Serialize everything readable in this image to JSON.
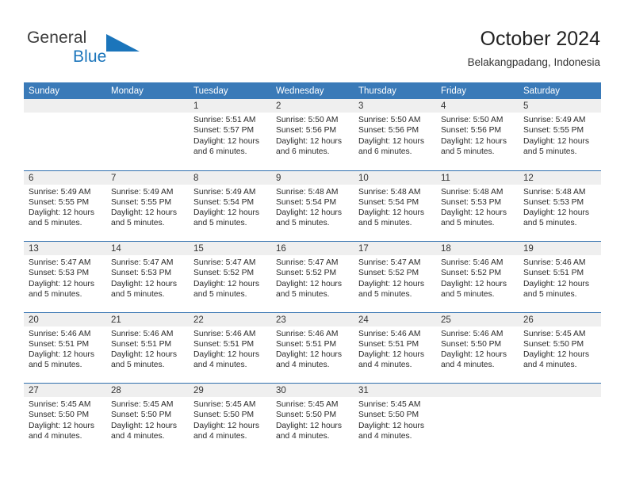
{
  "brand": {
    "name_part1": "General",
    "name_part2": "Blue",
    "triangle_icon": "triangle-icon",
    "accent_color": "#1b75bb"
  },
  "header": {
    "title": "October 2024",
    "location": "Belakangpadang, Indonesia"
  },
  "calendar": {
    "header_bg": "#3a7ab8",
    "daynum_bg": "#efefef",
    "row_line_color": "#2f6fae",
    "weekday_headers": [
      "Sunday",
      "Monday",
      "Tuesday",
      "Wednesday",
      "Thursday",
      "Friday",
      "Saturday"
    ],
    "weeks": [
      [
        {
          "day": "",
          "sunrise": "",
          "sunset": "",
          "daylight": ""
        },
        {
          "day": "",
          "sunrise": "",
          "sunset": "",
          "daylight": ""
        },
        {
          "day": "1",
          "sunrise": "Sunrise: 5:51 AM",
          "sunset": "Sunset: 5:57 PM",
          "daylight": "Daylight: 12 hours and 6 minutes."
        },
        {
          "day": "2",
          "sunrise": "Sunrise: 5:50 AM",
          "sunset": "Sunset: 5:56 PM",
          "daylight": "Daylight: 12 hours and 6 minutes."
        },
        {
          "day": "3",
          "sunrise": "Sunrise: 5:50 AM",
          "sunset": "Sunset: 5:56 PM",
          "daylight": "Daylight: 12 hours and 6 minutes."
        },
        {
          "day": "4",
          "sunrise": "Sunrise: 5:50 AM",
          "sunset": "Sunset: 5:56 PM",
          "daylight": "Daylight: 12 hours and 5 minutes."
        },
        {
          "day": "5",
          "sunrise": "Sunrise: 5:49 AM",
          "sunset": "Sunset: 5:55 PM",
          "daylight": "Daylight: 12 hours and 5 minutes."
        }
      ],
      [
        {
          "day": "6",
          "sunrise": "Sunrise: 5:49 AM",
          "sunset": "Sunset: 5:55 PM",
          "daylight": "Daylight: 12 hours and 5 minutes."
        },
        {
          "day": "7",
          "sunrise": "Sunrise: 5:49 AM",
          "sunset": "Sunset: 5:55 PM",
          "daylight": "Daylight: 12 hours and 5 minutes."
        },
        {
          "day": "8",
          "sunrise": "Sunrise: 5:49 AM",
          "sunset": "Sunset: 5:54 PM",
          "daylight": "Daylight: 12 hours and 5 minutes."
        },
        {
          "day": "9",
          "sunrise": "Sunrise: 5:48 AM",
          "sunset": "Sunset: 5:54 PM",
          "daylight": "Daylight: 12 hours and 5 minutes."
        },
        {
          "day": "10",
          "sunrise": "Sunrise: 5:48 AM",
          "sunset": "Sunset: 5:54 PM",
          "daylight": "Daylight: 12 hours and 5 minutes."
        },
        {
          "day": "11",
          "sunrise": "Sunrise: 5:48 AM",
          "sunset": "Sunset: 5:53 PM",
          "daylight": "Daylight: 12 hours and 5 minutes."
        },
        {
          "day": "12",
          "sunrise": "Sunrise: 5:48 AM",
          "sunset": "Sunset: 5:53 PM",
          "daylight": "Daylight: 12 hours and 5 minutes."
        }
      ],
      [
        {
          "day": "13",
          "sunrise": "Sunrise: 5:47 AM",
          "sunset": "Sunset: 5:53 PM",
          "daylight": "Daylight: 12 hours and 5 minutes."
        },
        {
          "day": "14",
          "sunrise": "Sunrise: 5:47 AM",
          "sunset": "Sunset: 5:53 PM",
          "daylight": "Daylight: 12 hours and 5 minutes."
        },
        {
          "day": "15",
          "sunrise": "Sunrise: 5:47 AM",
          "sunset": "Sunset: 5:52 PM",
          "daylight": "Daylight: 12 hours and 5 minutes."
        },
        {
          "day": "16",
          "sunrise": "Sunrise: 5:47 AM",
          "sunset": "Sunset: 5:52 PM",
          "daylight": "Daylight: 12 hours and 5 minutes."
        },
        {
          "day": "17",
          "sunrise": "Sunrise: 5:47 AM",
          "sunset": "Sunset: 5:52 PM",
          "daylight": "Daylight: 12 hours and 5 minutes."
        },
        {
          "day": "18",
          "sunrise": "Sunrise: 5:46 AM",
          "sunset": "Sunset: 5:52 PM",
          "daylight": "Daylight: 12 hours and 5 minutes."
        },
        {
          "day": "19",
          "sunrise": "Sunrise: 5:46 AM",
          "sunset": "Sunset: 5:51 PM",
          "daylight": "Daylight: 12 hours and 5 minutes."
        }
      ],
      [
        {
          "day": "20",
          "sunrise": "Sunrise: 5:46 AM",
          "sunset": "Sunset: 5:51 PM",
          "daylight": "Daylight: 12 hours and 5 minutes."
        },
        {
          "day": "21",
          "sunrise": "Sunrise: 5:46 AM",
          "sunset": "Sunset: 5:51 PM",
          "daylight": "Daylight: 12 hours and 5 minutes."
        },
        {
          "day": "22",
          "sunrise": "Sunrise: 5:46 AM",
          "sunset": "Sunset: 5:51 PM",
          "daylight": "Daylight: 12 hours and 4 minutes."
        },
        {
          "day": "23",
          "sunrise": "Sunrise: 5:46 AM",
          "sunset": "Sunset: 5:51 PM",
          "daylight": "Daylight: 12 hours and 4 minutes."
        },
        {
          "day": "24",
          "sunrise": "Sunrise: 5:46 AM",
          "sunset": "Sunset: 5:51 PM",
          "daylight": "Daylight: 12 hours and 4 minutes."
        },
        {
          "day": "25",
          "sunrise": "Sunrise: 5:46 AM",
          "sunset": "Sunset: 5:50 PM",
          "daylight": "Daylight: 12 hours and 4 minutes."
        },
        {
          "day": "26",
          "sunrise": "Sunrise: 5:45 AM",
          "sunset": "Sunset: 5:50 PM",
          "daylight": "Daylight: 12 hours and 4 minutes."
        }
      ],
      [
        {
          "day": "27",
          "sunrise": "Sunrise: 5:45 AM",
          "sunset": "Sunset: 5:50 PM",
          "daylight": "Daylight: 12 hours and 4 minutes."
        },
        {
          "day": "28",
          "sunrise": "Sunrise: 5:45 AM",
          "sunset": "Sunset: 5:50 PM",
          "daylight": "Daylight: 12 hours and 4 minutes."
        },
        {
          "day": "29",
          "sunrise": "Sunrise: 5:45 AM",
          "sunset": "Sunset: 5:50 PM",
          "daylight": "Daylight: 12 hours and 4 minutes."
        },
        {
          "day": "30",
          "sunrise": "Sunrise: 5:45 AM",
          "sunset": "Sunset: 5:50 PM",
          "daylight": "Daylight: 12 hours and 4 minutes."
        },
        {
          "day": "31",
          "sunrise": "Sunrise: 5:45 AM",
          "sunset": "Sunset: 5:50 PM",
          "daylight": "Daylight: 12 hours and 4 minutes."
        },
        {
          "day": "",
          "sunrise": "",
          "sunset": "",
          "daylight": ""
        },
        {
          "day": "",
          "sunrise": "",
          "sunset": "",
          "daylight": ""
        }
      ]
    ]
  }
}
